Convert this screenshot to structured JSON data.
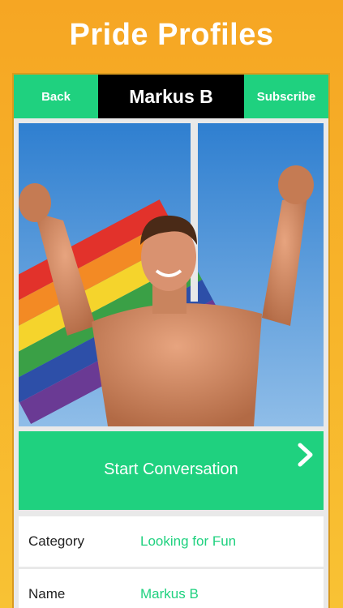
{
  "promo": {
    "title": "Pride Profiles"
  },
  "navbar": {
    "back_label": "Back",
    "title": "Markus B",
    "subscribe_label": "Subscribe"
  },
  "cta": {
    "label": "Start Conversation",
    "icon": "chevron-right-icon"
  },
  "details": [
    {
      "label": "Category",
      "value": "Looking for Fun"
    },
    {
      "label": "Name",
      "value": "Markus B"
    }
  ],
  "colors": {
    "accent": "#1fd17f",
    "background": "#f6a623",
    "navbar_title_bg": "#000000"
  }
}
